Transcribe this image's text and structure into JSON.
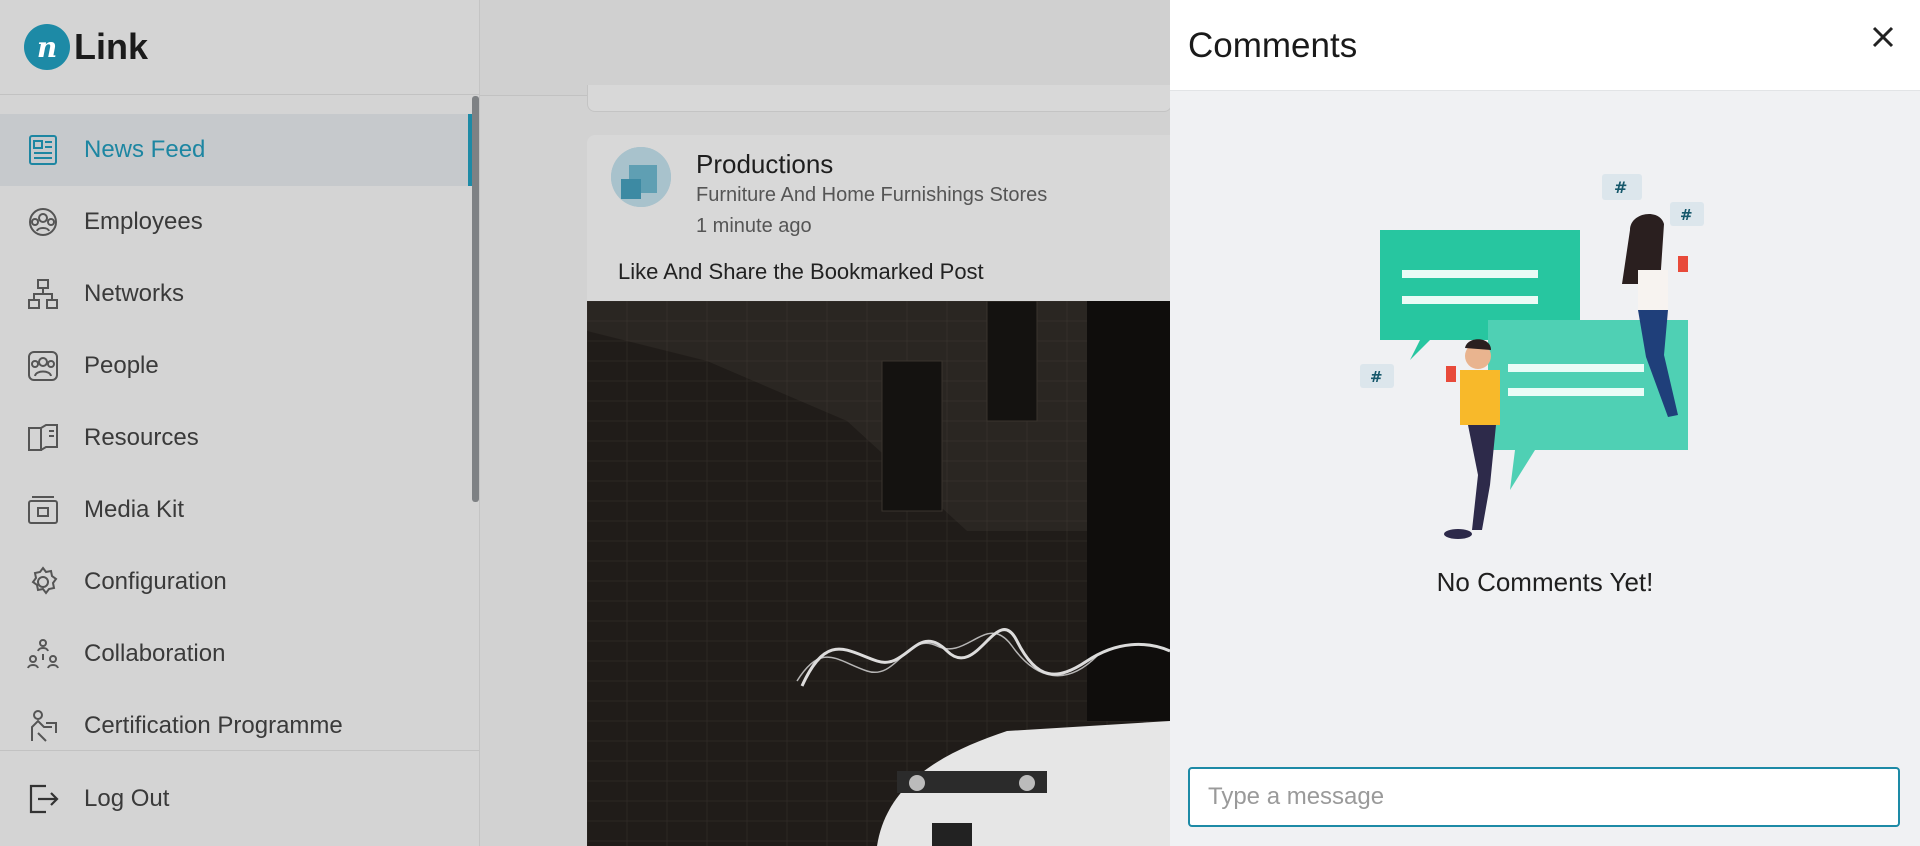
{
  "app": {
    "logo_letter": "n",
    "logo_text": "Link",
    "brand_color": "#1d8aa6"
  },
  "sidebar": {
    "items": [
      {
        "label": "News Feed",
        "icon": "newspaper-icon",
        "active": true
      },
      {
        "label": "Employees",
        "icon": "employees-icon",
        "active": false
      },
      {
        "label": "Networks",
        "icon": "network-icon",
        "active": false
      },
      {
        "label": "People",
        "icon": "people-icon",
        "active": false
      },
      {
        "label": "Resources",
        "icon": "book-icon",
        "active": false
      },
      {
        "label": "Media Kit",
        "icon": "media-kit-icon",
        "active": false
      },
      {
        "label": "Configuration",
        "icon": "gear-icon",
        "active": false
      },
      {
        "label": "Collaboration",
        "icon": "collaboration-icon",
        "active": false
      },
      {
        "label": "Certification Programme",
        "icon": "certification-icon",
        "active": false
      }
    ],
    "logout_label": "Log Out"
  },
  "post": {
    "title": "Productions",
    "subtitle": "Furniture And Home Furnishings Stores",
    "time": "1 minute ago",
    "text": "Like And Share the Bookmarked Post"
  },
  "comments": {
    "title": "Comments",
    "empty_text": "No Comments Yet!",
    "input_placeholder": "Type a message",
    "input_value": ""
  }
}
